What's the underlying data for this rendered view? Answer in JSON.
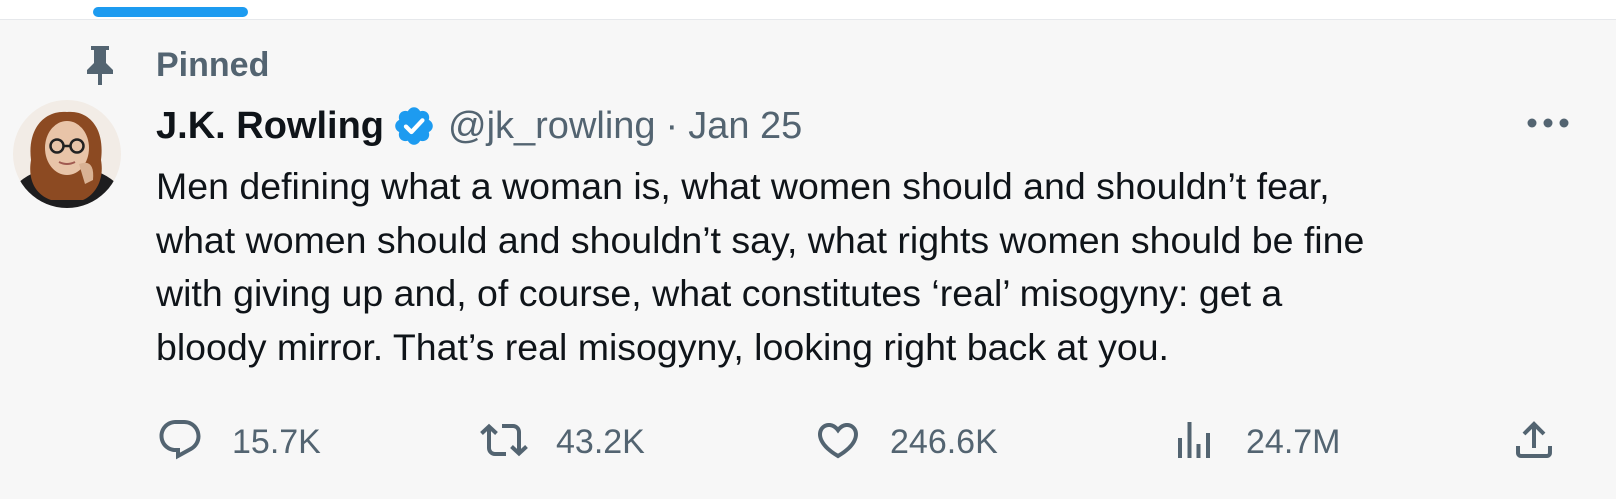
{
  "pinned": {
    "label": "Pinned"
  },
  "tweet": {
    "author_name": "J.K. Rowling",
    "verified": true,
    "handle": "@jk_rowling",
    "separator": "·",
    "date": "Jan 25",
    "text_lines": [
      "Men defining what a woman is, what women should and shouldn’t fear,",
      "what women should and shouldn’t say, what rights women should be fine",
      "with giving up and, of course, what constitutes ‘real’ misogyny: get a",
      "bloody mirror. That’s real misogyny, looking right back at you."
    ]
  },
  "actions": {
    "replies": "15.7K",
    "retweets": "43.2K",
    "likes": "246.6K",
    "views": "24.7M"
  },
  "colors": {
    "accent": "#1d9bf0",
    "secondary_text": "#536471",
    "primary_text": "#0f1419",
    "background": "#f7f7f7"
  },
  "icons": [
    "pin-icon",
    "verified-badge-icon",
    "more-icon",
    "reply-icon",
    "retweet-icon",
    "like-icon",
    "views-icon",
    "share-icon"
  ]
}
